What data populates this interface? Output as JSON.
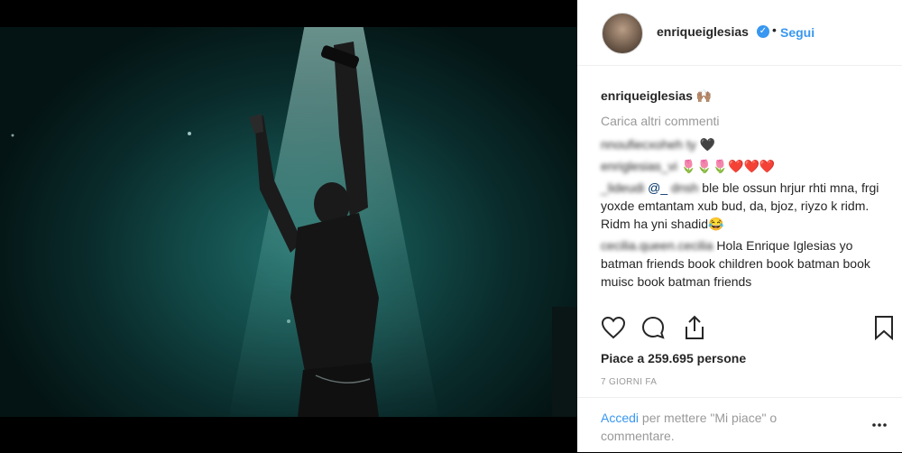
{
  "post": {
    "username": "enriqueiglesias",
    "follow_label": "Segui",
    "dot": "•",
    "verified_glyph": "✓"
  },
  "caption": {
    "username": "enriqueiglesias",
    "emoji": "🙌🏽"
  },
  "load_more_label": "Carica altri commenti",
  "comments": [
    {
      "username": "nnoufiecxoheh ty",
      "text": " 🖤"
    },
    {
      "username": "enriglesias_vi",
      "text": " 🌷🌷🌷❤️❤️❤️"
    },
    {
      "username": "_lideudi",
      "mention": "@_ ",
      "mention_blur": "dnsh",
      "text": "ble ble ossun hrjur rhti mna, frgi yoxde emtantam xub bud, da, bjoz, riyzo k ridm. Ridm ha yni shadid😂"
    },
    {
      "username": "cecilia.queen.cecilia",
      "text": " Hola Enrique Iglesias yo batman friends book children book batman book muisc book batman friends"
    }
  ],
  "likes_text": "Piace a 259.695 persone",
  "time_text": "7 GIORNI FA",
  "footer": {
    "login_label": "Accedi",
    "rest": " per mettere \"Mi piace\" o commentare."
  },
  "icons": {
    "like": "heart-icon",
    "comment": "comment-icon",
    "share": "share-icon",
    "save": "bookmark-icon",
    "more": "more-icon"
  },
  "colors": {
    "link": "#3897f0",
    "text": "#262626",
    "muted": "#999999"
  }
}
